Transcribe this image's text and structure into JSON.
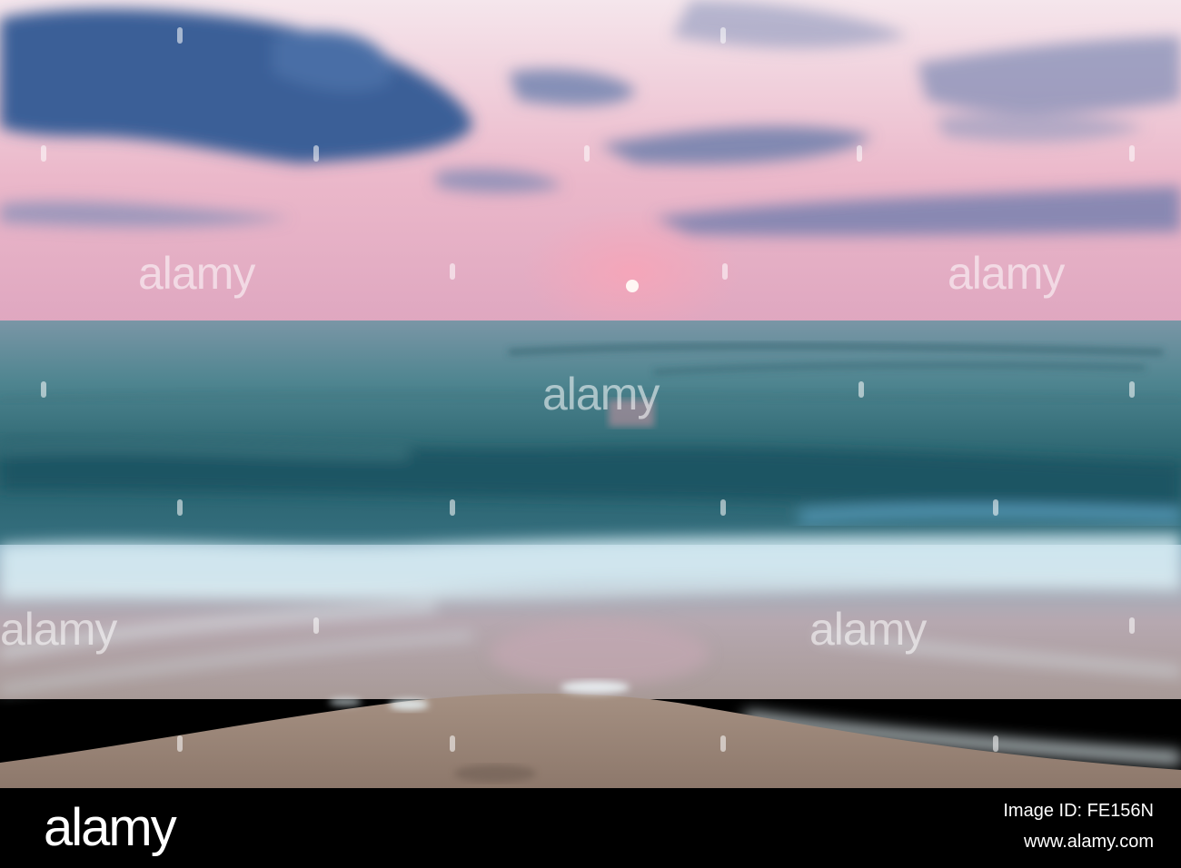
{
  "watermark": {
    "text": "alamy"
  },
  "footer": {
    "logo": "alamy",
    "image_id_label": "Image ID: FE156N",
    "site": "www.alamy.com"
  },
  "colors": {
    "sky_top": "#f2d9e2",
    "sky_pink": "#e9aec3",
    "cloud_blue": "#3b5f97",
    "sea": "#2e6e7d",
    "foam": "#d6eef5",
    "sand": "#9b8578",
    "footer": "#000000"
  }
}
